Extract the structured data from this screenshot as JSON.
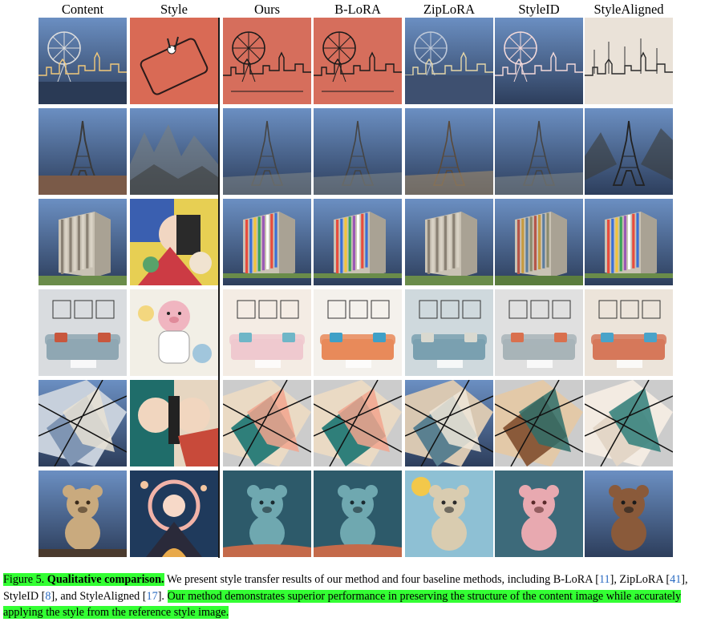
{
  "headers": [
    "Content",
    "Style",
    "Ours",
    "B-LoRA",
    "ZipLoRA",
    "StyleID",
    "StyleAligned"
  ],
  "rows": [
    {
      "theme": "london-skyline",
      "cells": [
        "london-photo",
        "phone-doodle",
        "london-red-lineart",
        "london-red-lineart",
        "london-river-photo",
        "london-red-photo",
        "london-sketch"
      ]
    },
    {
      "theme": "eiffel-tower",
      "cells": [
        "eiffel-sunset-photo",
        "ink-mountains",
        "eiffel-ink",
        "eiffel-ink",
        "eiffel-sepia",
        "eiffel-ink",
        "eiffel-ink-dark"
      ]
    },
    {
      "theme": "office-building",
      "cells": [
        "building-photo",
        "cubist-portrait",
        "building-colorful",
        "building-colorful",
        "building-photo",
        "building-colorful-muted",
        "building-colorful"
      ]
    },
    {
      "theme": "living-room",
      "cells": [
        "sofa-photo",
        "astronaut-pig",
        "sofa-pastel",
        "sofa-orange",
        "sofa-blue",
        "sofa-gray",
        "sofa-patterned"
      ]
    },
    {
      "theme": "glass-architecture",
      "cells": [
        "glass-building-photo",
        "cubist-faces",
        "shards-teal",
        "shards-teal",
        "shards-sky",
        "shards-brown",
        "shards-white"
      ]
    },
    {
      "theme": "teddy-bear",
      "cells": [
        "teddy-photo",
        "starry-landscape",
        "teddy-teal",
        "teddy-teal",
        "teddy-cartoon",
        "teddy-pink",
        "teddy-brown"
      ]
    }
  ],
  "caption": {
    "figure_label": "Figure 5.",
    "title": "Qualitative comparison.",
    "text_1": " We present style transfer results of our method and four baseline methods, including B-LoRA [",
    "ref_1": "11",
    "text_2": "], ZipLoRA [",
    "ref_2": "41",
    "text_3": "], StyleID [",
    "ref_3": "8",
    "text_4": "], and StyleAligned [",
    "ref_4": "17",
    "text_5": "]. ",
    "highlight": "Our method demonstrates superior performance in preserving the structure of the content image while accurately applying the style from the reference style image."
  },
  "colors": {
    "highlight": "#33ff33",
    "reference_link": "#2a6bc2",
    "divider": "#1a1a1a"
  }
}
